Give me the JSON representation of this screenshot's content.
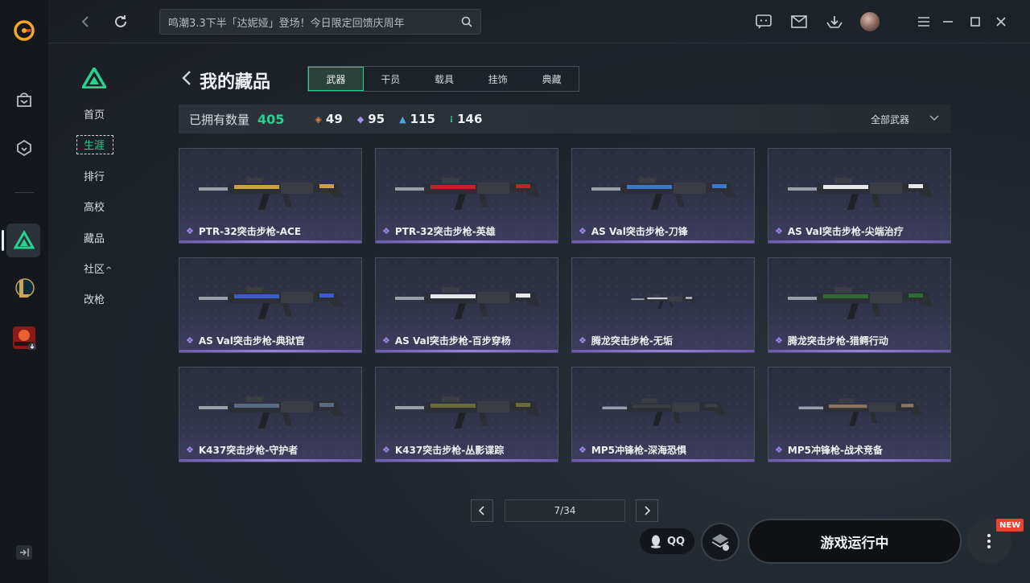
{
  "topbar": {
    "search_placeholder": "鸣潮3.3下半「达妮娅」登场！今日限定回馈庆周年"
  },
  "section_nav": {
    "items": [
      {
        "label": "首页"
      },
      {
        "label": "生涯",
        "active": true
      },
      {
        "label": "排行"
      },
      {
        "label": "高校"
      },
      {
        "label": "藏品"
      },
      {
        "label": "社区",
        "suffix": "^"
      },
      {
        "label": "改枪"
      }
    ]
  },
  "collection": {
    "title": "我的藏品",
    "tabs": [
      {
        "label": "武器",
        "active": true
      },
      {
        "label": "干员"
      },
      {
        "label": "载具"
      },
      {
        "label": "挂饰"
      },
      {
        "label": "典藏"
      }
    ],
    "owned_label": "已拥有数量",
    "owned_total": "405",
    "stats": [
      {
        "value": "49",
        "color": "#e8823a",
        "icon": "diamond-orange"
      },
      {
        "value": "95",
        "color": "#a58cf0",
        "icon": "diamond-purple"
      },
      {
        "value": "115",
        "color": "#4aa8e8",
        "icon": "chevron-blue"
      },
      {
        "value": "146",
        "color": "#27d28e",
        "icon": "dots-green"
      }
    ],
    "filter_label": "全部武器"
  },
  "items": [
    {
      "name": "PTR-32突击步枪-ACE",
      "accent": "#c9a23a"
    },
    {
      "name": "PTR-32突击步枪-英雄",
      "accent": "#c0242b"
    },
    {
      "name": "AS Val突击步枪-刀锋",
      "accent": "#3a78c9"
    },
    {
      "name": "AS Val突击步枪-尖端治疗",
      "accent": "#e6e8ea"
    },
    {
      "name": "AS Val突击步枪-典狱官",
      "accent": "#3a5bc9"
    },
    {
      "name": "AS Val突击步枪-百步穿杨",
      "accent": "#e6e8ea"
    },
    {
      "name": "腾龙突击步枪-无垢",
      "accent": "#c8ccd2"
    },
    {
      "name": "腾龙突击步枪-猎鳄行动",
      "accent": "#2e6b35"
    },
    {
      "name": "K437突击步枪-守护者",
      "accent": "#5a6a80"
    },
    {
      "name": "K437突击步枪-丛影谍踪",
      "accent": "#6b6a3a"
    },
    {
      "name": "MP5冲锋枪-深海恐惧",
      "accent": "#3a3e44"
    },
    {
      "name": "MP5冲锋枪-战术竞备",
      "accent": "#8a7560"
    }
  ],
  "pager": {
    "current": "7/34"
  },
  "bottom": {
    "qq_label": "QQ",
    "play_label": "游戏运行中",
    "new_badge": "NEW"
  }
}
